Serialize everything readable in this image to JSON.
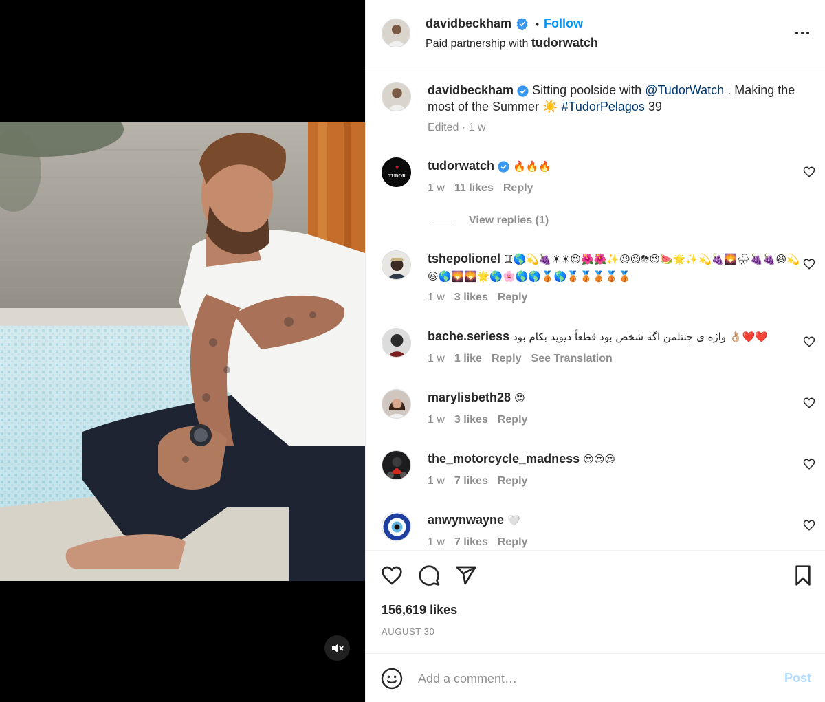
{
  "post": {
    "author": "davidbeckham",
    "follow_label": "Follow",
    "dot": "•",
    "partnership_prefix": "Paid partnership with",
    "partner": "tudorwatch",
    "mute_icon": "speaker-muted-icon"
  },
  "caption": {
    "username": "davidbeckham",
    "text_1": "Sitting poolside with",
    "mention": "@TudorWatch",
    "text_2": ". Making the most of the Summer ☀️",
    "hashtag": "#TudorPelagos",
    "text_3": "39",
    "meta": "Edited · 1 w"
  },
  "comments": [
    {
      "username": "tudorwatch",
      "verified": true,
      "text": "🔥🔥🔥",
      "time": "1 w",
      "likes": "11 likes",
      "reply": "Reply",
      "avatar_label": "TUDOR"
    },
    {
      "username": "tshepolionel",
      "verified": false,
      "text": "♊🌎💫🍇☀☀😉🌺🌺✨😉😉⛈😉🍉🌟✨💫🍇🌄🌧🍇🍇😆💫😆🌎🌄🌄🌟🌎🌸🌎🌎🥉🌎🥉🥉🥉🥉🥉",
      "time": "1 w",
      "likes": "3 likes",
      "reply": "Reply"
    },
    {
      "username": "bache.seriess",
      "verified": false,
      "text": "واژه ی جنتلمن اگه شخص بود قطعاً دیوید بکام بود 👌🏼❤️❤️",
      "time": "1 w",
      "likes": "1 like",
      "reply": "Reply",
      "translate": "See Translation"
    },
    {
      "username": "marylisbeth28",
      "verified": false,
      "text": "😍",
      "time": "1 w",
      "likes": "3 likes",
      "reply": "Reply"
    },
    {
      "username": "the_motorcycle_madness",
      "verified": false,
      "text": "😍😍😍",
      "time": "1 w",
      "likes": "7 likes",
      "reply": "Reply"
    },
    {
      "username": "anwynwayne",
      "verified": false,
      "text": "🤍",
      "time": "1 w",
      "likes": "7 likes",
      "reply": "Reply"
    }
  ],
  "view_replies": "View replies (1)",
  "actions": {
    "like_icon": "heart-outline-icon",
    "comment_icon": "comment-bubble-icon",
    "share_icon": "paper-plane-icon",
    "save_icon": "bookmark-icon",
    "likes": "156,619 likes",
    "date": "AUGUST 30"
  },
  "composer": {
    "placeholder": "Add a comment…",
    "post_label": "Post"
  },
  "colors": {
    "link": "#0095f6",
    "muted": "#8e8e8e",
    "hashtag": "#00376b",
    "post_disabled": "#b3dbff"
  }
}
